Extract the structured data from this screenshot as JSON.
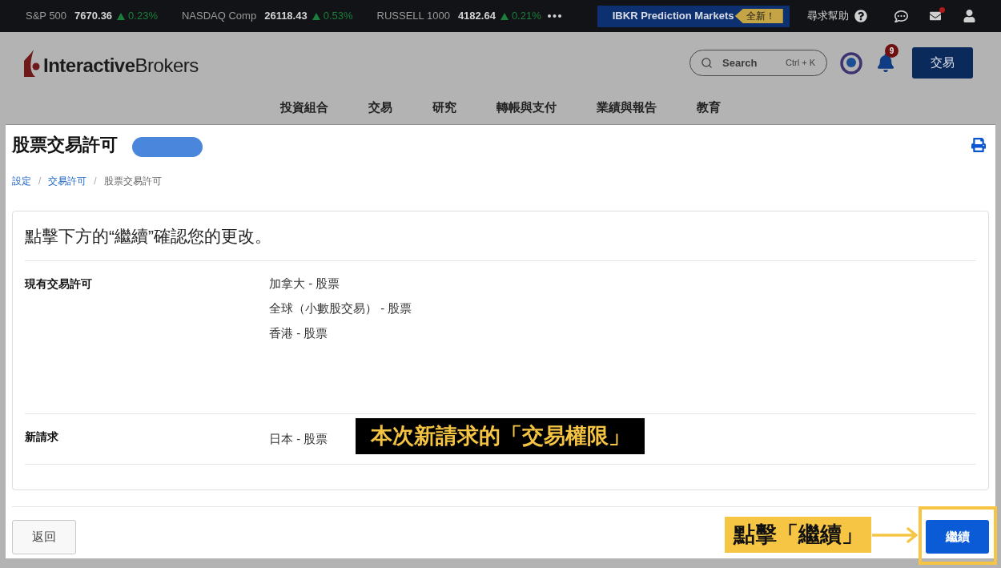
{
  "ticker": {
    "quotes": [
      {
        "name": "S&P 500",
        "value": "7670.36",
        "change": "0.23%",
        "up": true
      },
      {
        "name": "NASDAQ Comp",
        "value": "26118.43",
        "change": "0.53%",
        "up": true
      },
      {
        "name": "RUSSELL 1000",
        "value": "4182.64",
        "change": "0.21%",
        "up": true
      }
    ],
    "promo": {
      "label": "IBKR Prediction Markets",
      "tag": "全新！"
    },
    "help": "尋求幫助",
    "mail_unread": true
  },
  "header": {
    "brand": "**Interactive**Brokers",
    "search": {
      "placeholder": "Search",
      "shortcut": "Ctrl + K"
    },
    "notification_count": "9",
    "trade_button": "交易",
    "nav": [
      "投資組合",
      "交易",
      "研究",
      "轉帳與支付",
      "業績與報告",
      "教育"
    ]
  },
  "page": {
    "title": "股票交易許可",
    "breadcrumb": [
      {
        "label": "設定",
        "current": false,
        "separator": "/"
      },
      {
        "label": "交易許可",
        "current": false,
        "separator": "/"
      },
      {
        "label": "股票交易許可",
        "current": true
      }
    ],
    "confirmation": {
      "heading": "點擊下方的“繼續”確認您的更改。",
      "rows": [
        {
          "label": "現有交易許可",
          "values": [
            "加拿大 - 股票",
            "全球（小數股交易） - 股票",
            "香港 - 股票"
          ]
        },
        {
          "label": "新請求",
          "values": [
            "日本 - 股票"
          ]
        }
      ]
    },
    "footer": {
      "back_button": "返回",
      "continue_button": "繼續"
    }
  },
  "annotations": [
    {
      "kind": "callout",
      "text": "本次新請求的「交易權限」"
    },
    {
      "kind": "pointer",
      "text": "點擊「繼續」"
    }
  ]
}
